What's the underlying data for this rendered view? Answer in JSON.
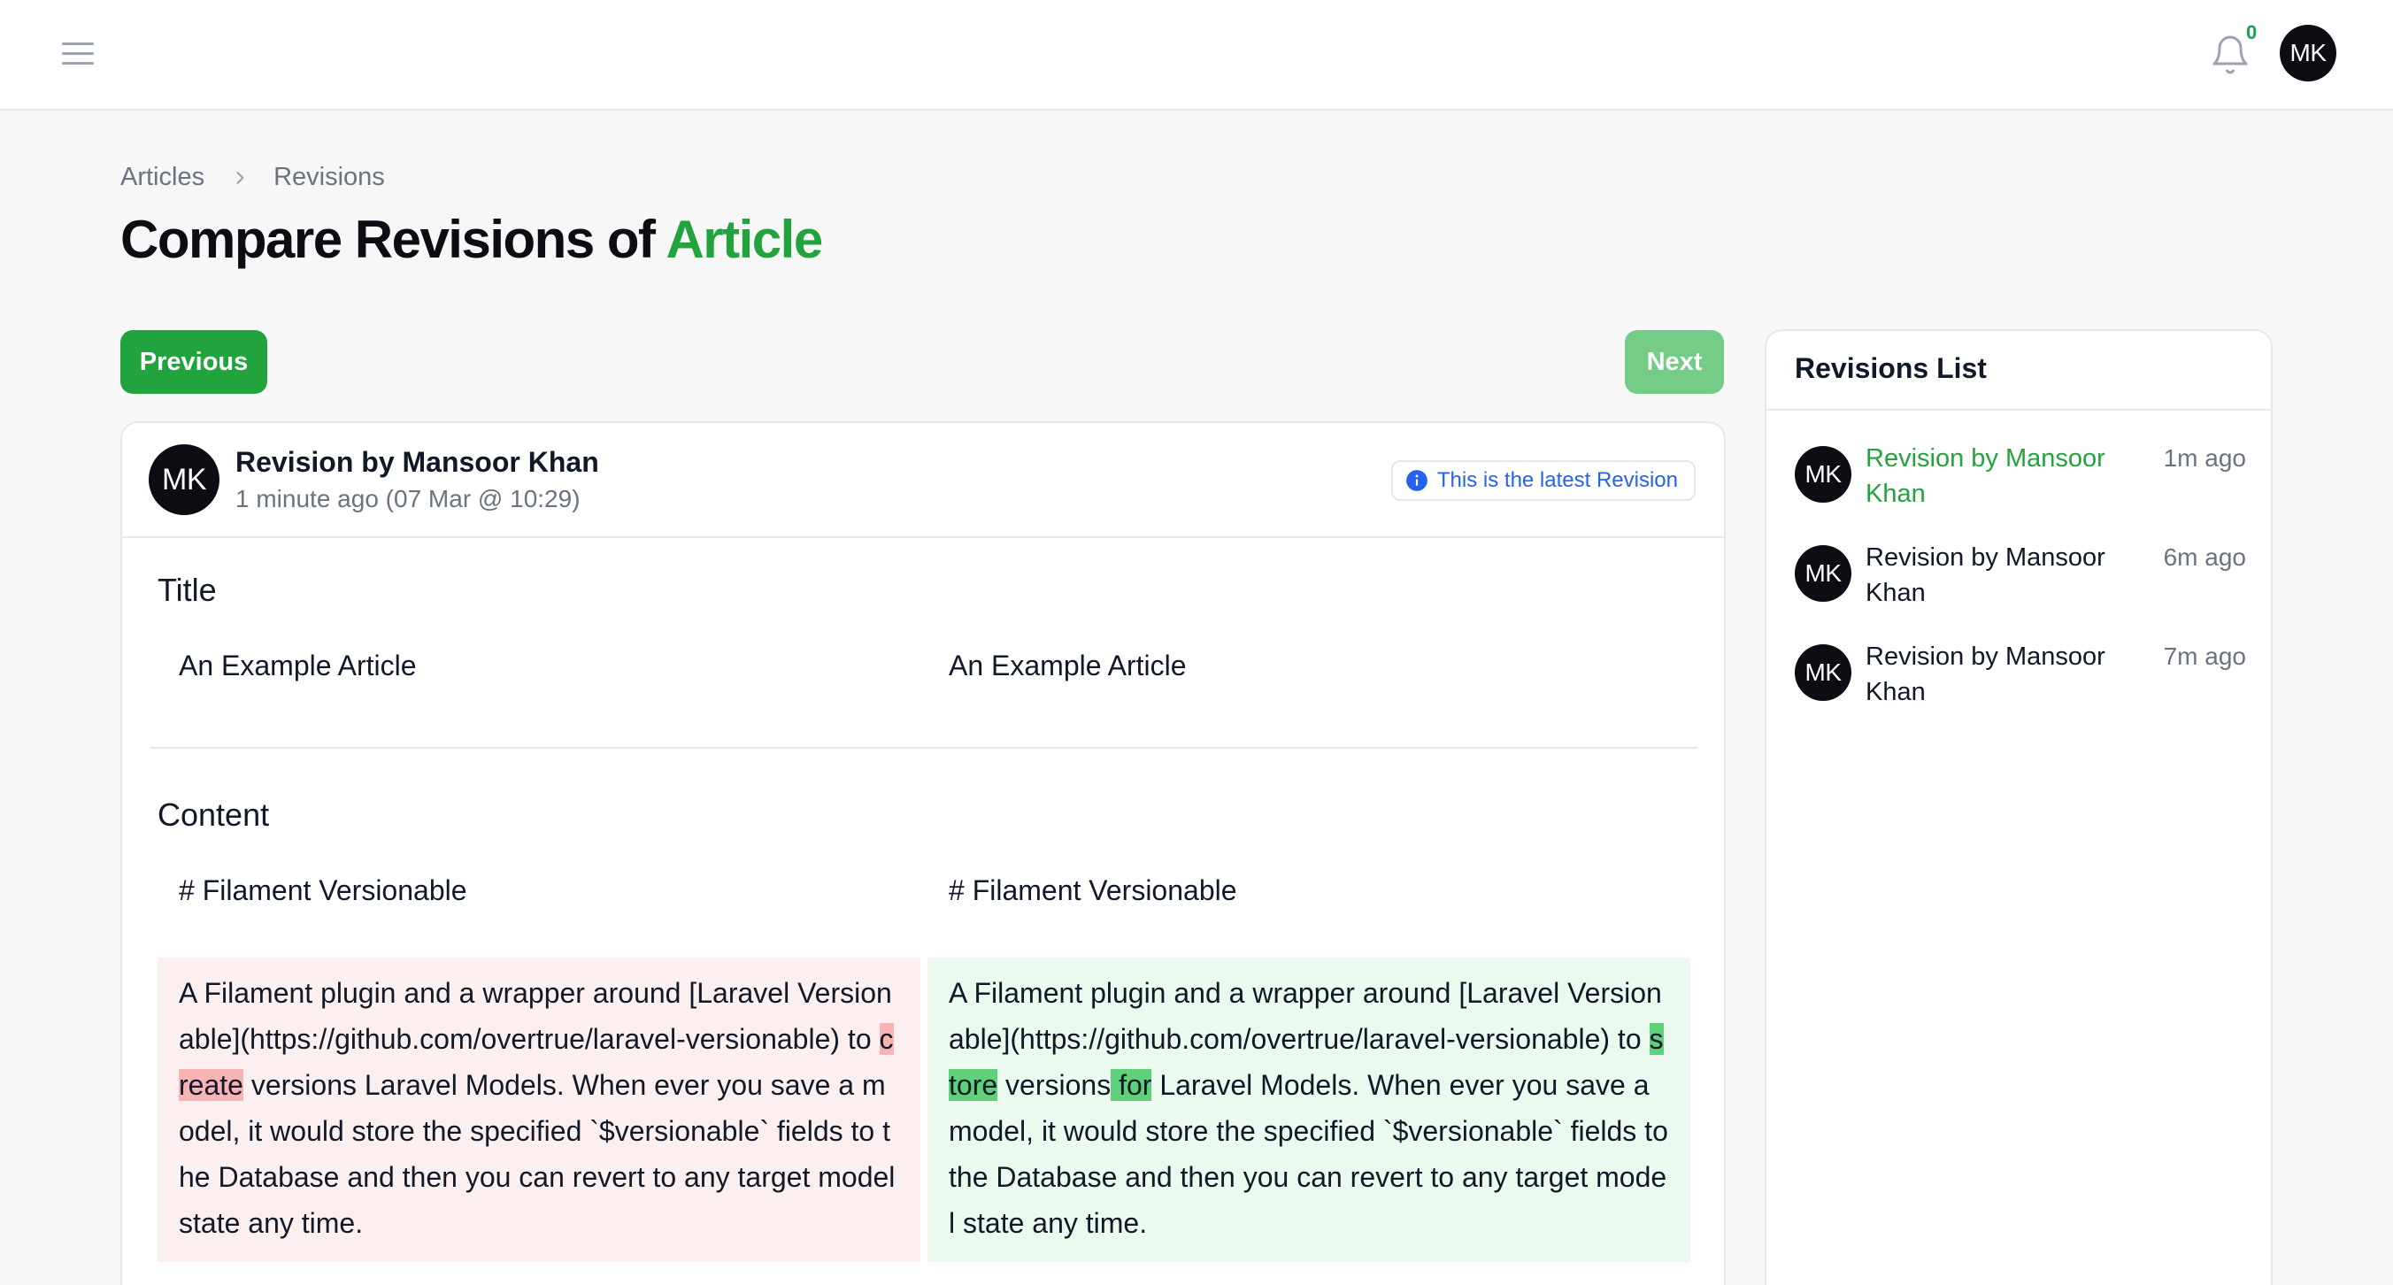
{
  "header": {
    "notification_count": "0",
    "user_initials": "MK"
  },
  "breadcrumb": {
    "items": [
      "Articles",
      "Revisions"
    ]
  },
  "page": {
    "title_prefix": "Compare Revisions of",
    "title_model": "Article"
  },
  "nav": {
    "previous_label": "Previous",
    "next_label": "Next"
  },
  "revision": {
    "initials": "MK",
    "author": "Revision by Mansoor Khan",
    "time": "1 minute ago (07 Mar @ 10:29)",
    "badge": "This is the latest Revision"
  },
  "fields": {
    "title": {
      "label": "Title",
      "old_value": "An Example Article",
      "new_value": "An Example Article"
    },
    "content": {
      "label": "Content",
      "old_heading": "# Filament Versionable",
      "new_heading": "# Filament Versionable",
      "old_before": "A Filament plugin and a wrapper around [Laravel Versionable](https://github.com/overtrue/laravel-versionable) to ",
      "old_deleted": "create",
      "old_after": " versions Laravel Models. When ever you save a model, it would store the specified `$versionable` fields to the Database and then you can revert to any target model state any time.",
      "new_before": "A Filament plugin and a wrapper around [Laravel Versionable](https://github.com/overtrue/laravel-versionable) to ",
      "new_inserted_1": "store",
      "new_middle": " versions",
      "new_inserted_2": " for",
      "new_after": " Laravel Models. When ever you save a model, it would store the specified `$versionable` fields to the Database and then you can revert to any target model state any time."
    }
  },
  "revisions_list": {
    "title": "Revisions List",
    "items": [
      {
        "initials": "MK",
        "label": "Revision by Mansoor Khan",
        "ago": "1m ago",
        "active": true
      },
      {
        "initials": "MK",
        "label": "Revision by Mansoor Khan",
        "ago": "6m ago",
        "active": false
      },
      {
        "initials": "MK",
        "label": "Revision by Mansoor Khan",
        "ago": "7m ago",
        "active": false
      }
    ]
  },
  "colors": {
    "primary": "#22a33e",
    "primary_light": "#74cc86",
    "deleted_bg": "#fcefef",
    "deleted_mark": "#f8b4b4",
    "inserted_bg": "#ecf9ef",
    "inserted_mark": "#5fd17a",
    "info": "#2563eb"
  },
  "icons": [
    "menu-icon",
    "bell-icon",
    "chevron-right-icon",
    "info-icon"
  ]
}
